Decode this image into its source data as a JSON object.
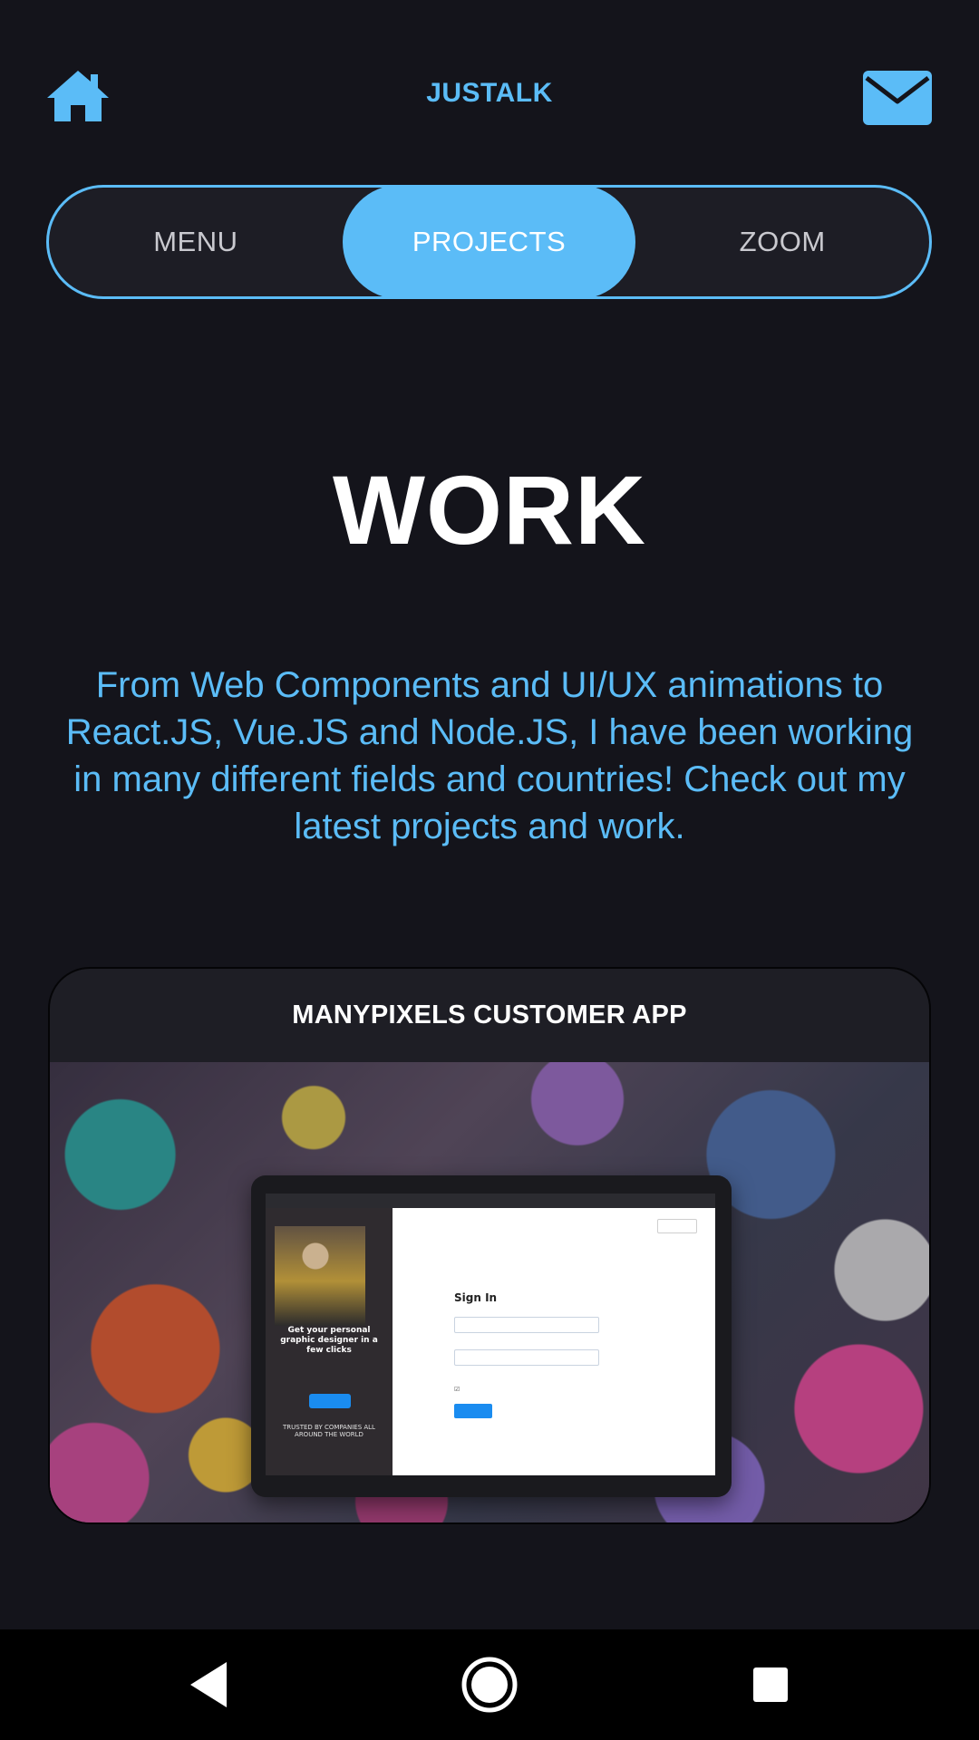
{
  "header": {
    "brand": "JUSTALK",
    "home_icon": "home-icon",
    "mail_icon": "mail-icon",
    "accent_color": "#5bbcf7"
  },
  "tabs": [
    {
      "label": "MENU",
      "active": false
    },
    {
      "label": "PROJECTS",
      "active": true
    },
    {
      "label": "ZOOM",
      "active": false
    }
  ],
  "hero": {
    "title": "WORK",
    "intro": "From Web Components and UI/UX animations to React.JS, Vue.JS and Node.JS, I have been working in many different fields and countries! Check out my latest projects and work."
  },
  "project_card": {
    "title": "MANYPIXELS CUSTOMER APP",
    "screenshot": {
      "signin_heading": "Sign In",
      "left_pane_text": "Get your personal graphic designer in a few clicks",
      "left_pane_footer": "TRUSTED BY COMPANIES ALL AROUND THE WORLD"
    }
  },
  "system_nav": {
    "back_icon": "back-triangle-icon",
    "home_icon": "home-circle-icon",
    "recents_icon": "recents-square-icon"
  }
}
